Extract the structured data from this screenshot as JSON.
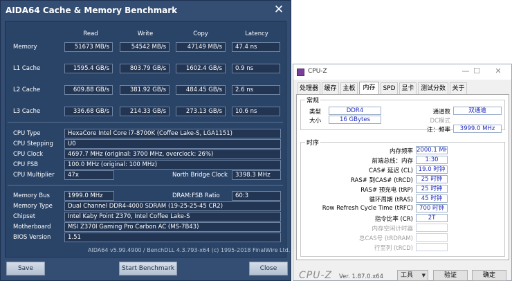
{
  "aida": {
    "title": "AIDA64 Cache & Memory Benchmark",
    "close_glyph": "✕",
    "columns": [
      "Read",
      "Write",
      "Copy",
      "Latency"
    ],
    "rows": [
      {
        "label": "Memory",
        "read": "51673 MB/s",
        "write": "54542 MB/s",
        "copy": "47149 MB/s",
        "latency": "47.4 ns"
      },
      {
        "label": "L1 Cache",
        "read": "1595.4 GB/s",
        "write": "803.79 GB/s",
        "copy": "1602.4 GB/s",
        "latency": "0.9 ns"
      },
      {
        "label": "L2 Cache",
        "read": "609.88 GB/s",
        "write": "381.92 GB/s",
        "copy": "484.45 GB/s",
        "latency": "2.6 ns"
      },
      {
        "label": "L3 Cache",
        "read": "336.68 GB/s",
        "write": "214.33 GB/s",
        "copy": "273.13 GB/s",
        "latency": "10.6 ns"
      }
    ],
    "cpu_type_label": "CPU Type",
    "cpu_type": "HexaCore Intel Core i7-8700K  (Coffee Lake-S, LGA1151)",
    "cpu_stepping_label": "CPU Stepping",
    "cpu_stepping": "U0",
    "cpu_clock_label": "CPU Clock",
    "cpu_clock": "4697.7 MHz  (original: 3700 MHz, overclock: 26%)",
    "cpu_fsb_label": "CPU FSB",
    "cpu_fsb": "100.0 MHz  (original: 100 MHz)",
    "cpu_multiplier_label": "CPU Multiplier",
    "cpu_multiplier": "47x",
    "nb_clock_label": "North Bridge Clock",
    "nb_clock": "3398.3 MHz",
    "memory_bus_label": "Memory Bus",
    "memory_bus": "1999.0 MHz",
    "dram_fsb_label": "DRAM:FSB Ratio",
    "dram_fsb": "60:3",
    "memory_type_label": "Memory Type",
    "memory_type": "Dual Channel DDR4-4000 SDRAM  (19-25-25-45 CR2)",
    "chipset_label": "Chipset",
    "chipset": "Intel Kaby Point Z370, Intel Coffee Lake-S",
    "motherboard_label": "Motherboard",
    "motherboard": "MSI Z370I Gaming Pro Carbon AC (MS-7B43)",
    "bios_label": "BIOS Version",
    "bios": "1.51",
    "footer": "AIDA64 v5.99.4900 / BenchDLL 4.3.793-x64  (c) 1995-2018 FinalWire Ltd.",
    "save_label": "Save",
    "start_label": "Start Benchmark",
    "close_label": "Close"
  },
  "cpuz": {
    "title": "CPU-Z",
    "min_glyph": "—",
    "max_glyph": "☐",
    "close_glyph": "✕",
    "tabs": [
      "处理器",
      "缓存",
      "主板",
      "内存",
      "SPD",
      "显卡",
      "测试分数",
      "关于"
    ],
    "active_tab": "内存",
    "general_title": "常规",
    "type_label": "类型",
    "type_value": "DDR4",
    "size_label": "大小",
    "size_value": "16 GBytes",
    "channels_label": "通道数",
    "channels_value": "双通道",
    "dc_label": "DC模式",
    "nb_label": "注：频率",
    "nb_value": "3999.0 MHz",
    "timings_title": "时序",
    "timings": [
      {
        "label": "内存频率",
        "value": "2000.1 MHz"
      },
      {
        "label": "前端总线：内存",
        "value": "1:30"
      },
      {
        "label": "CAS# 延迟 (CL)",
        "value": "19.0 时钟"
      },
      {
        "label": "RAS# 到CAS# (tRCD)",
        "value": "25 时钟"
      },
      {
        "label": "RAS# 预充电 (tRP)",
        "value": "25 时钟"
      },
      {
        "label": "循环周期 (tRAS)",
        "value": "45 时钟"
      },
      {
        "label": "Row Refresh Cycle Time (tRFC)",
        "value": "700 时钟"
      },
      {
        "label": "指令比率 (CR)",
        "value": "2T"
      }
    ],
    "dim_rows": [
      {
        "label": "内存空闲计时器"
      },
      {
        "label": "总CAS号 (tRDRAM)"
      },
      {
        "label": "行至列 (tRCD)"
      }
    ],
    "footer_logo": "CPU-Z",
    "version": "Ver. 1.87.0.x64",
    "tools_label": "工具",
    "validate_label": "验证",
    "ok_label": "确定"
  }
}
